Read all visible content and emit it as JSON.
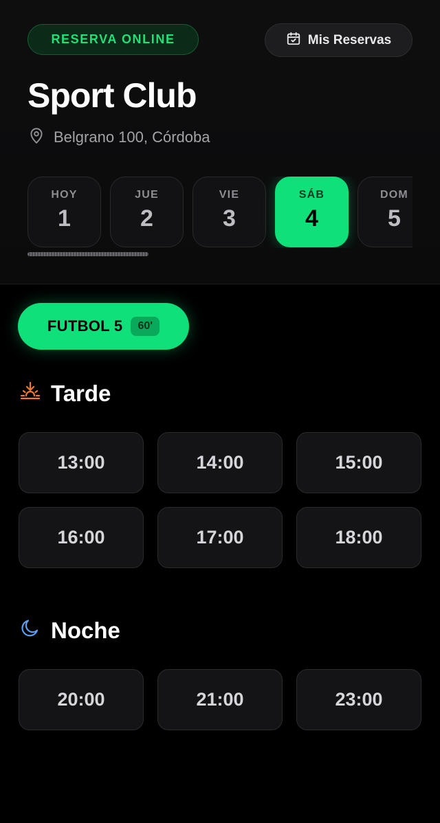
{
  "header": {
    "badge": "RESERVA ONLINE",
    "reservations_button": "Mis Reservas",
    "club_name": "Sport Club",
    "address": "Belgrano 100, Córdoba"
  },
  "days": [
    {
      "name": "HOY",
      "number": "1",
      "selected": false
    },
    {
      "name": "JUE",
      "number": "2",
      "selected": false
    },
    {
      "name": "VIE",
      "number": "3",
      "selected": false
    },
    {
      "name": "SÁB",
      "number": "4",
      "selected": true
    },
    {
      "name": "DOM",
      "number": "5",
      "selected": false
    }
  ],
  "sport": {
    "name": "FUTBOL 5",
    "duration": "60'"
  },
  "sections": [
    {
      "title": "Tarde",
      "icon": "sunset-icon",
      "icon_color": "#f07a2c",
      "slots": [
        "13:00",
        "14:00",
        "15:00",
        "16:00",
        "17:00",
        "18:00"
      ]
    },
    {
      "title": "Noche",
      "icon": "moon-icon",
      "icon_color": "#5aa0f0",
      "slots": [
        "20:00",
        "21:00",
        "23:00"
      ]
    }
  ],
  "colors": {
    "accent": "#0fe07a",
    "background": "#000000"
  }
}
